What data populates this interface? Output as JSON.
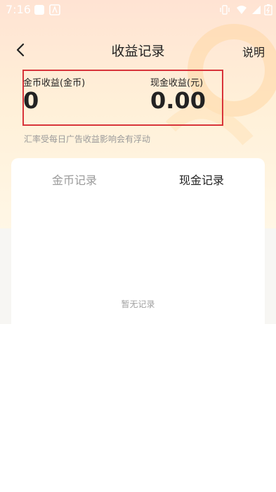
{
  "status_bar": {
    "time": "7:16"
  },
  "nav": {
    "back_icon": "chevron-left-icon",
    "title": "收益记录",
    "help_label": "说明"
  },
  "earnings": {
    "coin_label": "金币收益(金币)",
    "coin_value": "0",
    "cash_label": "现金收益(元)",
    "cash_value": "0.00",
    "note": "汇率受每日广告收益影响会有浮动"
  },
  "tabs": [
    {
      "label": "金币记录",
      "active": false
    },
    {
      "label": "现金记录",
      "active": true
    }
  ],
  "empty_text": "暂无记录",
  "colors": {
    "highlight_border": "#d8343a",
    "inactive_tab": "#9a9a9a",
    "note_text": "#9a9a9a"
  }
}
